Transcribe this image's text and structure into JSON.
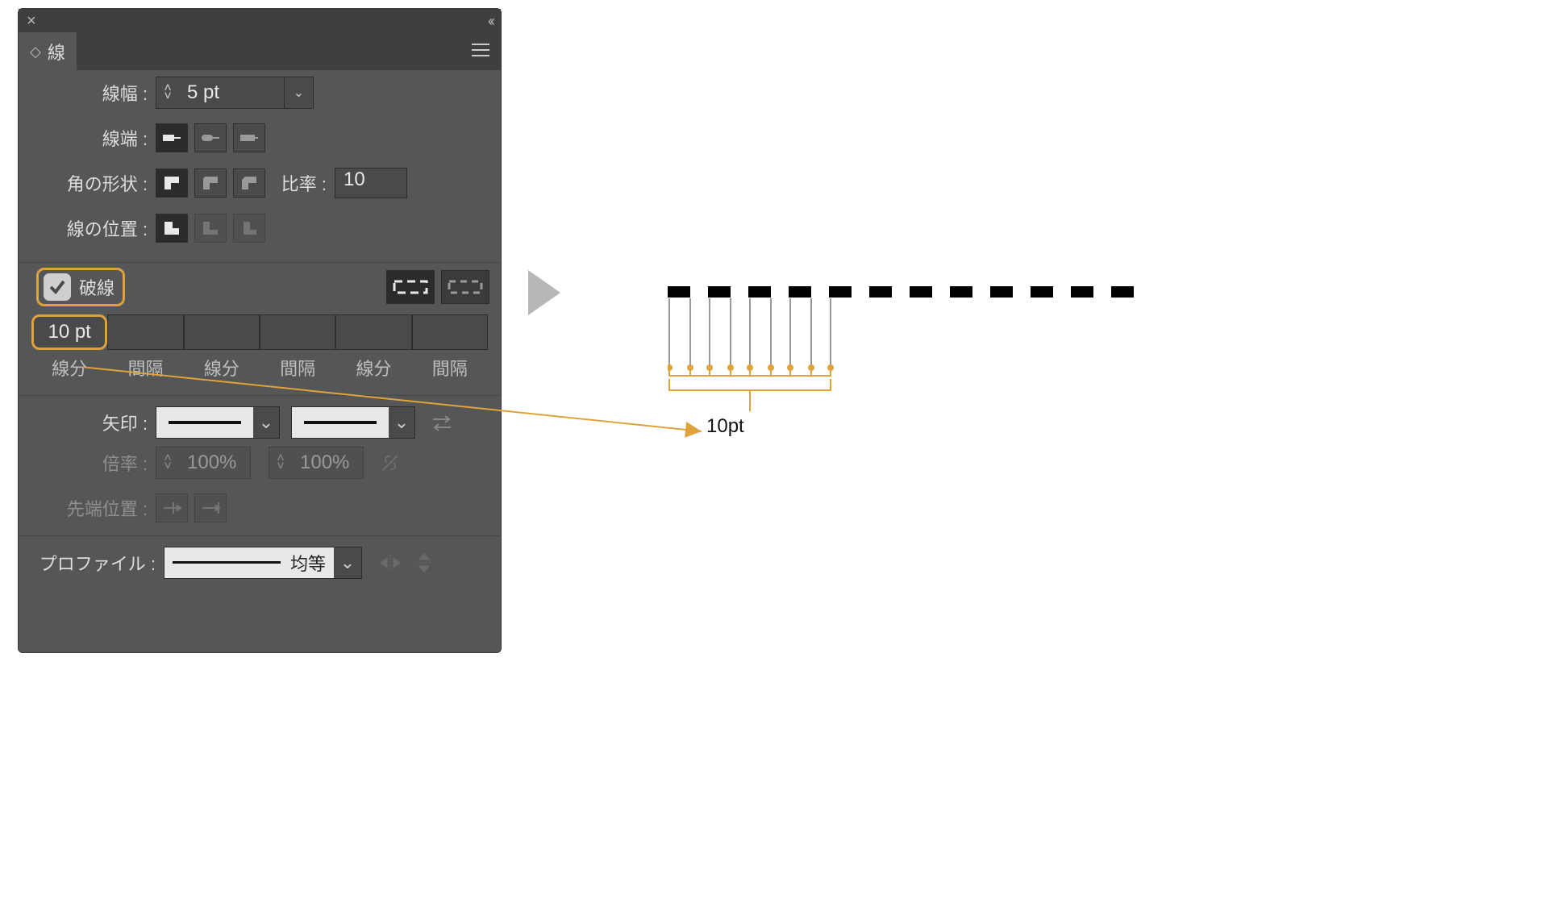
{
  "panel": {
    "title": "線",
    "weight": {
      "label": "線幅 :",
      "value": "5 pt"
    },
    "cap": {
      "label": "線端 :"
    },
    "corner": {
      "label": "角の形状 :",
      "ratio_label": "比率 :",
      "ratio_value": "10"
    },
    "align": {
      "label": "線の位置 :"
    },
    "dashed": {
      "checkbox_label": "破線",
      "fields": [
        {
          "value": "10 pt",
          "label": "線分"
        },
        {
          "value": "",
          "label": "間隔"
        },
        {
          "value": "",
          "label": "線分"
        },
        {
          "value": "",
          "label": "間隔"
        },
        {
          "value": "",
          "label": "線分"
        },
        {
          "value": "",
          "label": "間隔"
        }
      ]
    },
    "arrows": {
      "label": "矢印 :"
    },
    "scale": {
      "label": "倍率 :",
      "value1": "100%",
      "value2": "100%"
    },
    "tip": {
      "label": "先端位置 :"
    },
    "profile": {
      "label": "プロファイル :",
      "value": "均等"
    }
  },
  "annotation": {
    "label": "10pt"
  }
}
